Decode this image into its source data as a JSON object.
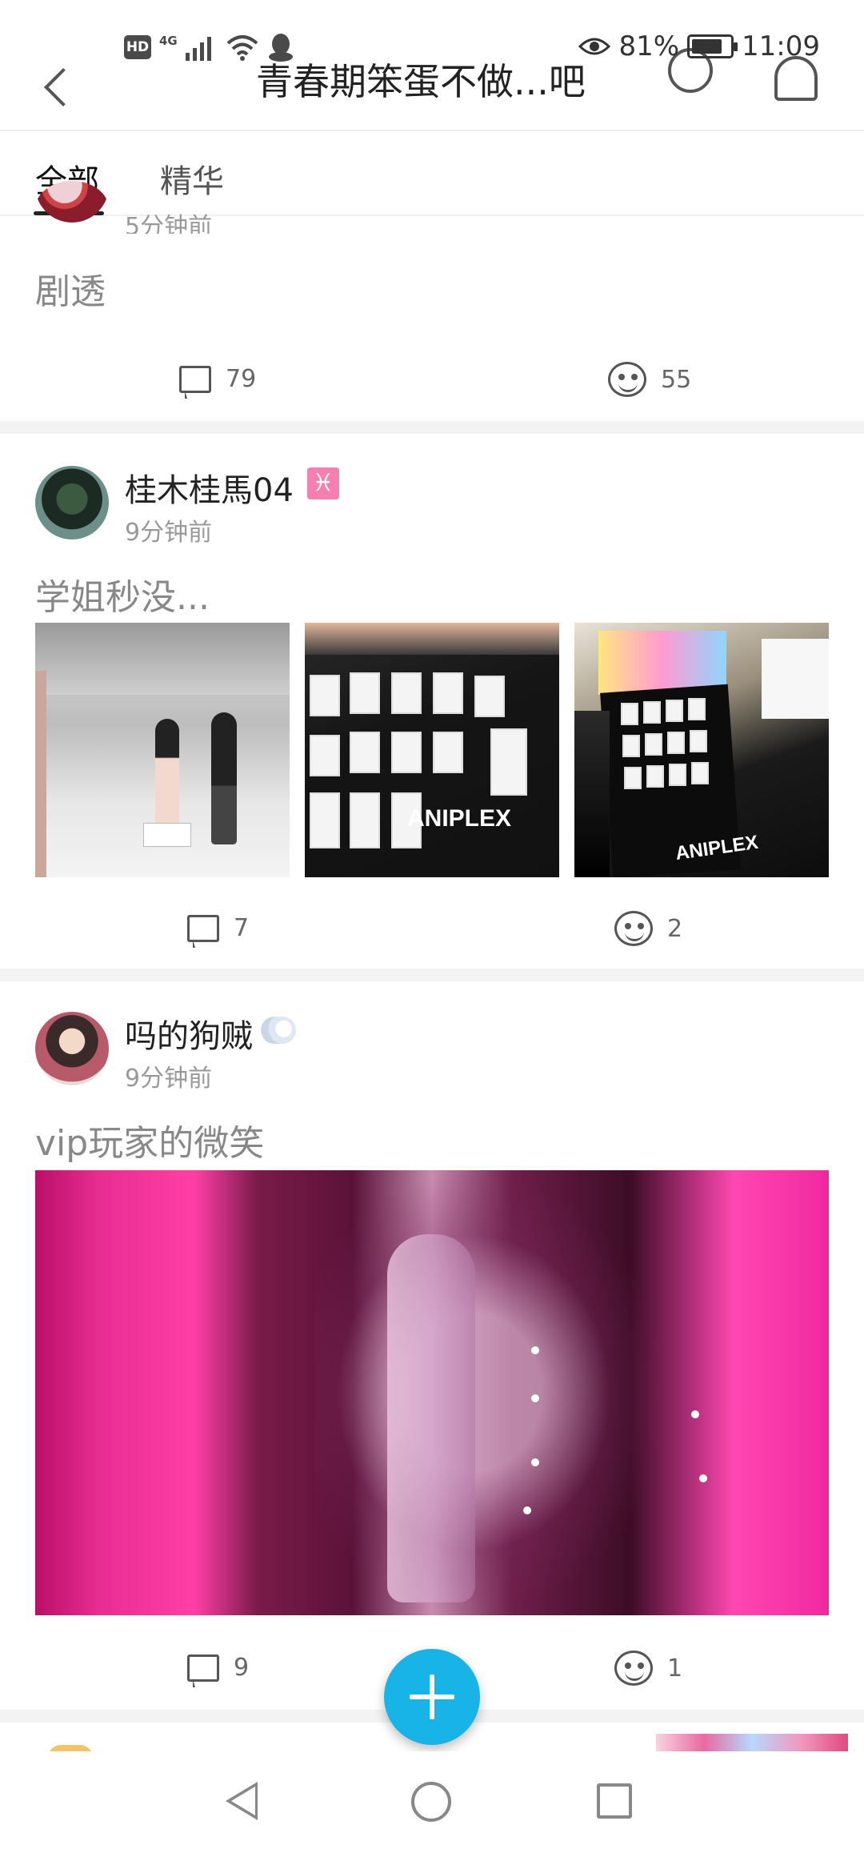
{
  "status_bar": {
    "hd": "HD",
    "network": "4G",
    "battery": "81%",
    "battery_level": 0.81,
    "time": "11:09"
  },
  "header": {
    "title": "青春期笨蛋不做...吧"
  },
  "tabs": {
    "all": "全部",
    "featured": "精华"
  },
  "posts": [
    {
      "time": "5分钟前",
      "content": "剧透",
      "comments": "79",
      "likes": "55"
    },
    {
      "username": "桂木桂馬04",
      "zodiac": "♓",
      "time": "9分钟前",
      "content": "学姐秒没...",
      "comments": "7",
      "likes": "2",
      "image_brand_1": "ANIPLEX",
      "image_brand_2": "ANIPLEX"
    },
    {
      "username": "吗的狗贼",
      "time": "9分钟前",
      "content": "vip玩家的微笑",
      "comments": "9",
      "likes": "1"
    }
  ],
  "colors": {
    "accent": "#18b4e8",
    "zodiac_badge": "#f47fb0"
  }
}
